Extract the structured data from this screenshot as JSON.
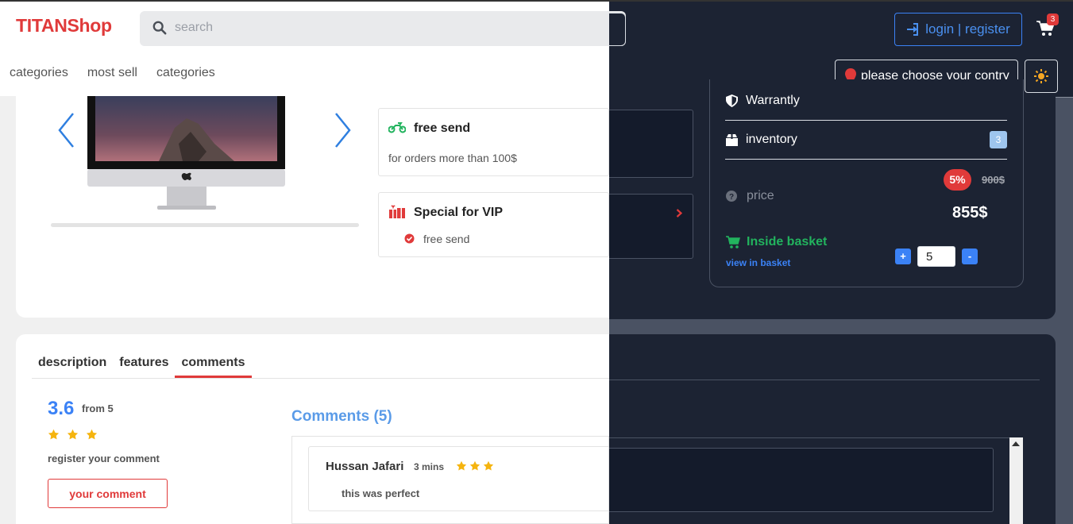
{
  "header": {
    "logo": "TITANShop",
    "search_placeholder": "search",
    "nav": [
      "categories",
      "most sell",
      "categories"
    ],
    "login_label": "login | register",
    "cart_count": "3",
    "country_label": "please choose your contry"
  },
  "product": {
    "features": [
      {
        "title": "free send",
        "subtitle": "for orders more than 100$"
      },
      {
        "title": "Special for VIP",
        "subtitle": "free send"
      }
    ]
  },
  "side_panel": {
    "warranty_label": "Warrantly",
    "inventory_label": "inventory",
    "inventory_count": "3",
    "price_label": "price",
    "discount": "5%",
    "old_price": "900$",
    "new_price": "855$",
    "basket_status": "Inside basket",
    "view_basket": "view in basket",
    "quantity": "5",
    "plus": "+",
    "minus": "-"
  },
  "reviews": {
    "tabs": [
      "description",
      "features",
      "comments"
    ],
    "active_tab": "comments",
    "rating": "3.6",
    "rating_from": "from 5",
    "stars": 3,
    "register_text": "register your comment",
    "comment_button": "your comment",
    "comments_title": "Comments (5)",
    "comments": [
      {
        "name": "Hussan Jafari",
        "time": "3 mins",
        "stars": 3,
        "text": "this was perfect"
      }
    ]
  },
  "colors": {
    "brand": "#e03a3a",
    "accent": "#3b82f6",
    "success": "#22b35e",
    "dark_bg": "#1c2333",
    "star": "#f5b40f"
  }
}
